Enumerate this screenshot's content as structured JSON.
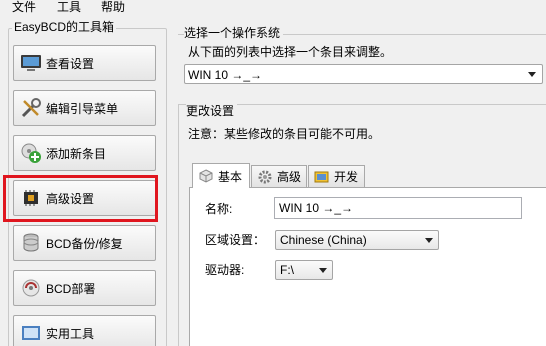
{
  "menu": [
    {
      "label": "文件"
    },
    {
      "label": "工具"
    },
    {
      "label": "帮助"
    }
  ],
  "toolbox": {
    "title": "EasyBCD的工具箱",
    "buttons": [
      {
        "label": "查看设置",
        "icon": "monitor-icon"
      },
      {
        "label": "编辑引导菜单",
        "icon": "tools-icon"
      },
      {
        "label": "添加新条目",
        "icon": "add-entry-icon"
      },
      {
        "label": "高级设置",
        "icon": "chip-icon"
      },
      {
        "label": "BCD备份/修复",
        "icon": "database-icon"
      },
      {
        "label": "BCD部署",
        "icon": "deploy-icon"
      },
      {
        "label": "实用工具",
        "icon": "utilities-icon"
      }
    ],
    "highlighted": "高级设置",
    "highlight_color": "#e0161f"
  },
  "os_group": {
    "title": "选择一个操作系统",
    "instruction": "从下面的列表中选择一个条目来调整。",
    "selected_os": "WIN 10 →_→"
  },
  "change_group": {
    "title": "更改设置",
    "note": "注意：某些修改的条目可能不可用。",
    "tabs": [
      {
        "label": "基本",
        "icon": "cube-icon",
        "active": true
      },
      {
        "label": "高级",
        "icon": "gear-icon",
        "active": false
      },
      {
        "label": "开发",
        "icon": "developer-icon",
        "active": false
      }
    ],
    "fields": {
      "name_label": "名称:",
      "name_value": "WIN 10 →_→",
      "locale_label": "区域设置：",
      "locale_value": "Chinese (China)",
      "drive_label": "驱动器:",
      "drive_value": "F:\\"
    }
  }
}
